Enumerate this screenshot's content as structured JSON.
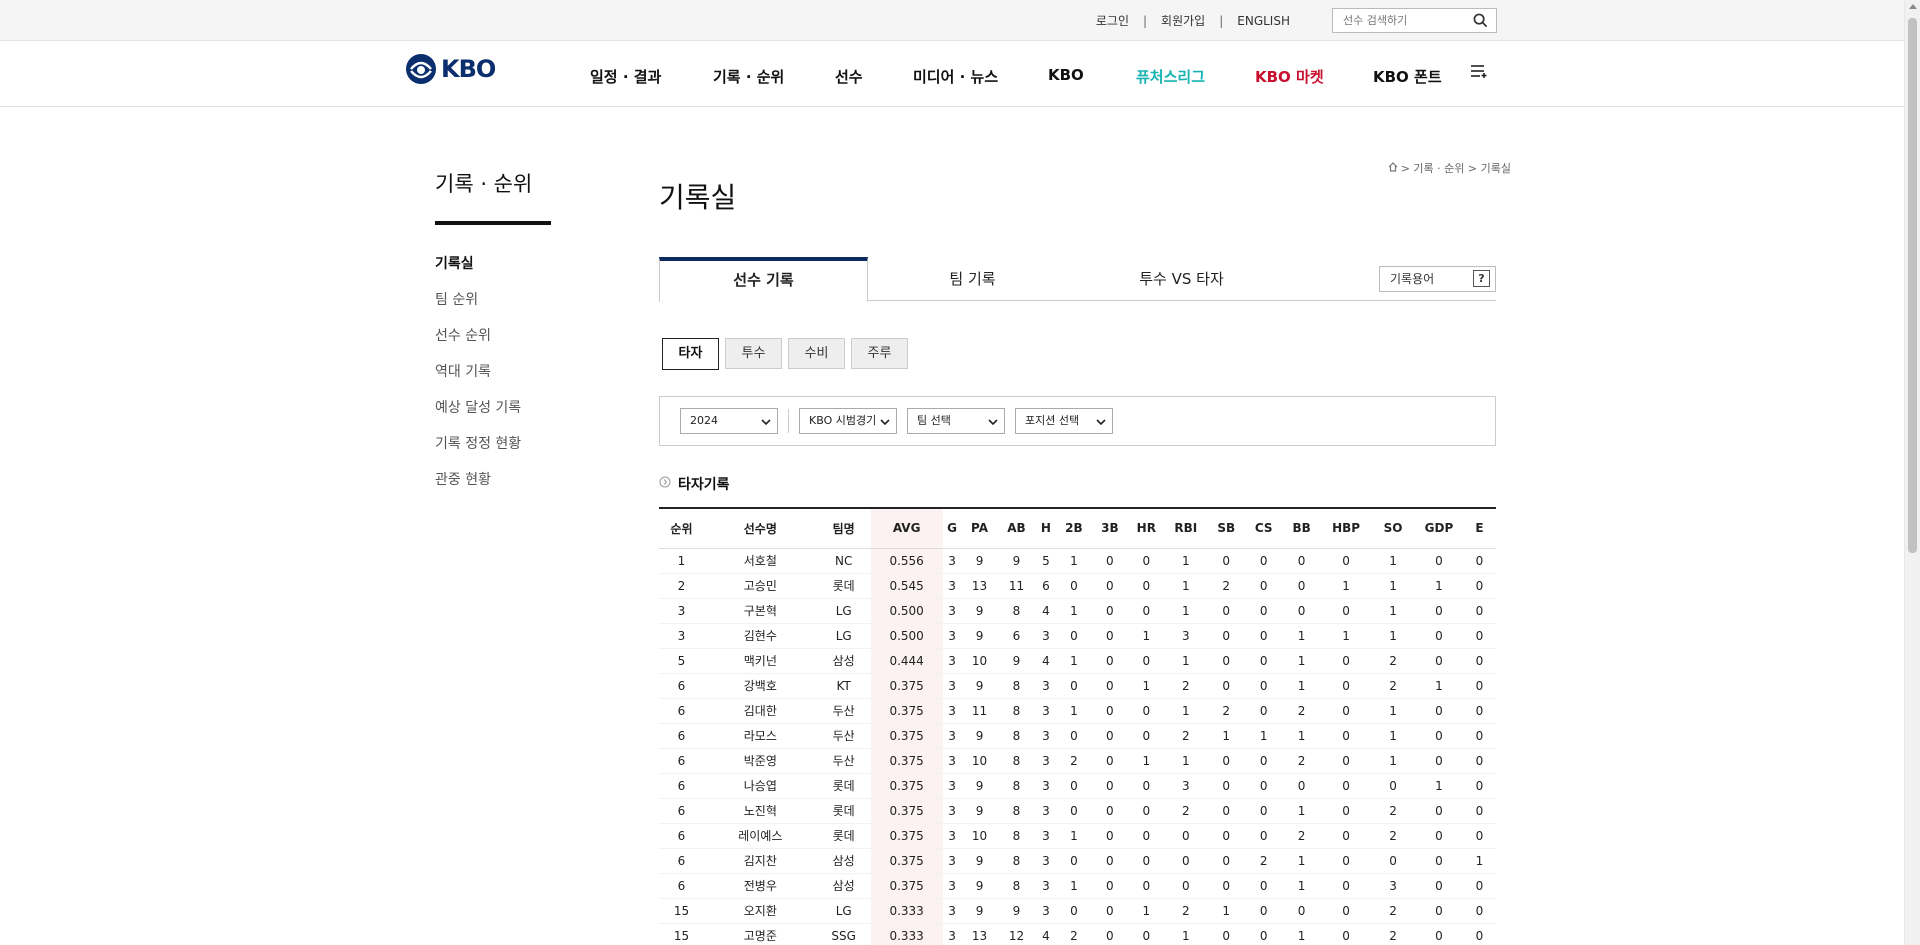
{
  "util": {
    "login": "로그인",
    "join": "회원가입",
    "english": "ENGLISH",
    "sep": "|",
    "search_placeholder": "선수 검색하기"
  },
  "header": {
    "logo_text": "KBO",
    "nav": [
      {
        "label": "일정 · 결과",
        "color": "#111111"
      },
      {
        "label": "기록 · 순위",
        "color": "#111111"
      },
      {
        "label": "선수",
        "color": "#111111"
      },
      {
        "label": "미디어 · 뉴스",
        "color": "#111111"
      },
      {
        "label": "KBO",
        "color": "#111111"
      },
      {
        "label": "퓨처스리그",
        "color": "#17b3b3"
      },
      {
        "label": "KBO 마켓",
        "color": "#c8102e"
      },
      {
        "label": "KBO 폰트",
        "color": "#111111"
      }
    ]
  },
  "sidebar": {
    "title": "기록 · 순위",
    "items": [
      {
        "label": "기록실"
      },
      {
        "label": "팀 순위"
      },
      {
        "label": "선수 순위"
      },
      {
        "label": "역대 기록"
      },
      {
        "label": "예상 달성 기록"
      },
      {
        "label": "기록 정정 현황"
      },
      {
        "label": "관중 현황"
      }
    ]
  },
  "breadcrumb": {
    "sep": ">",
    "items": [
      "기록 · 순위",
      "기록실"
    ]
  },
  "main": {
    "title": "기록실",
    "tabs": [
      {
        "label": "선수 기록"
      },
      {
        "label": "팀 기록"
      },
      {
        "label": "투수 VS 타자"
      }
    ],
    "term_button": "기록용어",
    "term_q": "?",
    "subtabs": [
      {
        "label": "타자"
      },
      {
        "label": "투수"
      },
      {
        "label": "수비"
      },
      {
        "label": "주루"
      }
    ],
    "filters": {
      "year": "2024",
      "series": "KBO 시범경기",
      "team": "팀 선택",
      "position": "포지션 선택"
    },
    "section_title": "타자기록"
  },
  "table": {
    "headers": [
      "순위",
      "선수명",
      "팀명",
      "AVG",
      "G",
      "PA",
      "AB",
      "H",
      "2B",
      "3B",
      "HR",
      "RBI",
      "SB",
      "CS",
      "BB",
      "HBP",
      "SO",
      "GDP",
      "E"
    ],
    "rows": [
      [
        "1",
        "서호철",
        "NC",
        "0.556",
        "3",
        "9",
        "9",
        "5",
        "1",
        "0",
        "0",
        "1",
        "0",
        "0",
        "0",
        "0",
        "1",
        "0",
        "0"
      ],
      [
        "2",
        "고승민",
        "롯데",
        "0.545",
        "3",
        "13",
        "11",
        "6",
        "0",
        "0",
        "0",
        "1",
        "2",
        "0",
        "0",
        "1",
        "1",
        "1",
        "0"
      ],
      [
        "3",
        "구본혁",
        "LG",
        "0.500",
        "3",
        "9",
        "8",
        "4",
        "1",
        "0",
        "0",
        "1",
        "0",
        "0",
        "0",
        "0",
        "1",
        "0",
        "0"
      ],
      [
        "3",
        "김현수",
        "LG",
        "0.500",
        "3",
        "9",
        "6",
        "3",
        "0",
        "0",
        "1",
        "3",
        "0",
        "0",
        "1",
        "1",
        "1",
        "0",
        "0"
      ],
      [
        "5",
        "맥키넌",
        "삼성",
        "0.444",
        "3",
        "10",
        "9",
        "4",
        "1",
        "0",
        "0",
        "1",
        "0",
        "0",
        "1",
        "0",
        "2",
        "0",
        "0"
      ],
      [
        "6",
        "강백호",
        "KT",
        "0.375",
        "3",
        "9",
        "8",
        "3",
        "0",
        "0",
        "1",
        "2",
        "0",
        "0",
        "1",
        "0",
        "2",
        "1",
        "0"
      ],
      [
        "6",
        "김대한",
        "두산",
        "0.375",
        "3",
        "11",
        "8",
        "3",
        "1",
        "0",
        "0",
        "1",
        "2",
        "0",
        "2",
        "0",
        "1",
        "0",
        "0"
      ],
      [
        "6",
        "라모스",
        "두산",
        "0.375",
        "3",
        "9",
        "8",
        "3",
        "0",
        "0",
        "0",
        "2",
        "1",
        "1",
        "1",
        "0",
        "1",
        "0",
        "0"
      ],
      [
        "6",
        "박준영",
        "두산",
        "0.375",
        "3",
        "10",
        "8",
        "3",
        "2",
        "0",
        "1",
        "1",
        "0",
        "0",
        "2",
        "0",
        "1",
        "0",
        "0"
      ],
      [
        "6",
        "나승엽",
        "롯데",
        "0.375",
        "3",
        "9",
        "8",
        "3",
        "0",
        "0",
        "0",
        "3",
        "0",
        "0",
        "0",
        "0",
        "0",
        "1",
        "0"
      ],
      [
        "6",
        "노진혁",
        "롯데",
        "0.375",
        "3",
        "9",
        "8",
        "3",
        "0",
        "0",
        "0",
        "2",
        "0",
        "0",
        "1",
        "0",
        "2",
        "0",
        "0"
      ],
      [
        "6",
        "레이예스",
        "롯데",
        "0.375",
        "3",
        "10",
        "8",
        "3",
        "1",
        "0",
        "0",
        "0",
        "0",
        "0",
        "2",
        "0",
        "2",
        "0",
        "0"
      ],
      [
        "6",
        "김지찬",
        "삼성",
        "0.375",
        "3",
        "9",
        "8",
        "3",
        "0",
        "0",
        "0",
        "0",
        "0",
        "2",
        "1",
        "0",
        "0",
        "0",
        "1"
      ],
      [
        "6",
        "전병우",
        "삼성",
        "0.375",
        "3",
        "9",
        "8",
        "3",
        "1",
        "0",
        "0",
        "0",
        "0",
        "0",
        "1",
        "0",
        "3",
        "0",
        "0"
      ],
      [
        "15",
        "오지환",
        "LG",
        "0.333",
        "3",
        "9",
        "9",
        "3",
        "0",
        "0",
        "1",
        "2",
        "1",
        "0",
        "0",
        "0",
        "2",
        "0",
        "0"
      ],
      [
        "15",
        "고명준",
        "SSG",
        "0.333",
        "3",
        "13",
        "12",
        "4",
        "2",
        "0",
        "0",
        "1",
        "0",
        "0",
        "1",
        "0",
        "2",
        "0",
        "0"
      ]
    ]
  },
  "colors": {
    "brand_navy": "#0d2a5e",
    "futures": "#17b3b3",
    "market": "#c8102e",
    "avg_highlight": "#fdf2f2"
  }
}
